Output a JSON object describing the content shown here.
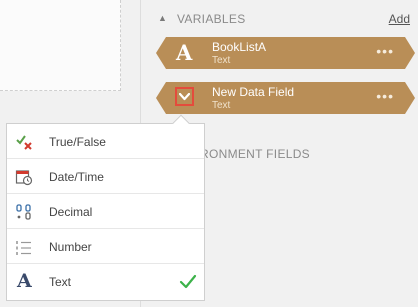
{
  "variables_section": {
    "title": "VARIABLES",
    "add_label": "Add"
  },
  "variables": [
    {
      "type_letter": "A",
      "name": "BookListA",
      "type": "Text",
      "more": "•••"
    },
    {
      "name": "New Data Field",
      "type": "Text",
      "more": "•••"
    }
  ],
  "environment_section": {
    "title": "RONMENT FIELDS"
  },
  "type_dropdown": {
    "items": [
      {
        "label": "True/False",
        "icon": "true-false-icon"
      },
      {
        "label": "Date/Time",
        "icon": "calendar-clock-icon"
      },
      {
        "label": "Decimal",
        "icon": "decimal-icon"
      },
      {
        "label": "Number",
        "icon": "number-list-icon"
      },
      {
        "label": "Text",
        "icon": "text-icon",
        "icon_glyph": "A",
        "selected": true
      }
    ]
  },
  "colors": {
    "variable_card": "#b98e57",
    "highlight_border": "#e44b3c",
    "check": "#3cb24a"
  }
}
